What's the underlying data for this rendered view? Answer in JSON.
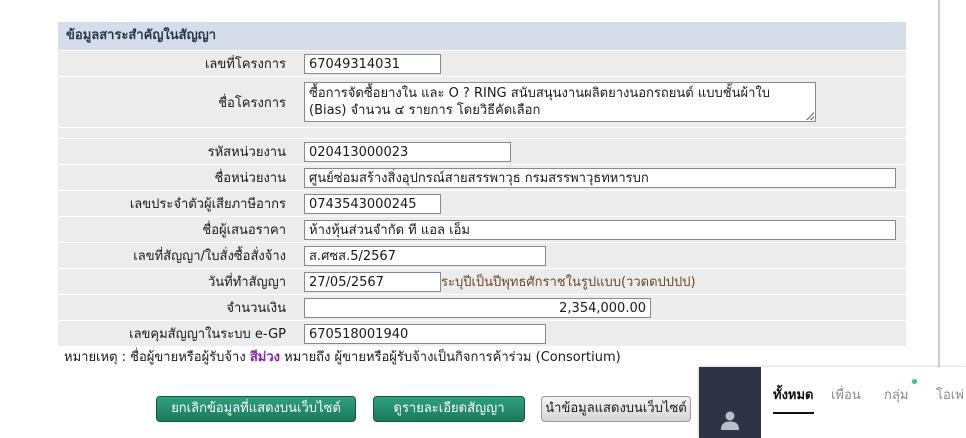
{
  "panel": {
    "title": "ข้อมูลสาระสำคัญในสัญญา",
    "fields": {
      "project_no": {
        "label": "เลขที่โครงการ",
        "value": "67049314031"
      },
      "project_name": {
        "label": "ชื่อโครงการ",
        "line1": "ซื้อการจัดซื้อยางใน และ O ? RING สนับสนุนงานผลิตยางนอกรถยนต์ แบบชั้นผ้าใบ",
        "line2": "(Bias) จำนวน ๔ รายการ โดยวิธีคัดเลือก"
      },
      "agency_code": {
        "label": "รหัสหน่วยงาน",
        "value": "020413000023"
      },
      "agency_name": {
        "label": "ชื่อหน่วยงาน",
        "value": "ศูนย์ซ่อมสร้างสิ่งอุปกรณ์สายสรรพาวุธ กรมสรรพาวุธทหารบก"
      },
      "tax_id": {
        "label": "เลขประจำตัวผู้เสียภาษีอากร",
        "value": "0743543000245"
      },
      "bidder": {
        "label": "ชื่อผู้เสนอราคา",
        "value": "ห้างหุ้นส่วนจำกัด ที แอล เอ็ม"
      },
      "contract_no": {
        "label": "เลขที่สัญญา/ใบสั่งซื้อสั่งจ้าง",
        "value": "ส.ศซส.5/2567"
      },
      "contract_date": {
        "label": "วันที่ทำสัญญา",
        "value": "27/05/2567",
        "hint": "ระบุปีเป็นปีพุทธศักราชในรูปแบบ(ววดดปปปป)"
      },
      "amount": {
        "label": "จำนวนเงิน",
        "value": "2,354,000.00"
      },
      "egp_no": {
        "label": "เลขคุมสัญญาในระบบ e-GP",
        "value": "670518001940"
      }
    }
  },
  "note": {
    "prefix": "หมายเหตุ : ชื่อผู้ขายหรือผู้รับจ้าง",
    "highlight": "สีม่วง",
    "suffix": "หมายถึง ผู้ขายหรือผู้รับจ้างเป็นกิจการค้าร่วม (Consortium)"
  },
  "buttons": {
    "cancel_display": "ยกเลิกข้อมูลที่แสดงบนเว็บไซต์",
    "contract_detail": "ดูรายละเอียดสัญญา",
    "publish": "นำข้อมูลแสดงบนเว็บไซต์"
  },
  "chat": {
    "tabs": [
      "ทั้งหมด",
      "เพื่อน",
      "กลุ่ม",
      "โอเพ่"
    ],
    "active_tab": "ทั้งหมด",
    "online_dot_color": "#2ecc71",
    "side_color": "#2d3443"
  },
  "colors": {
    "header_bg": "#d4dde9",
    "row_bg": "#ececec",
    "green_button": "#1a7a5c",
    "consortium_purple": "#8a1fb8",
    "hint_text": "#6b4a26"
  }
}
